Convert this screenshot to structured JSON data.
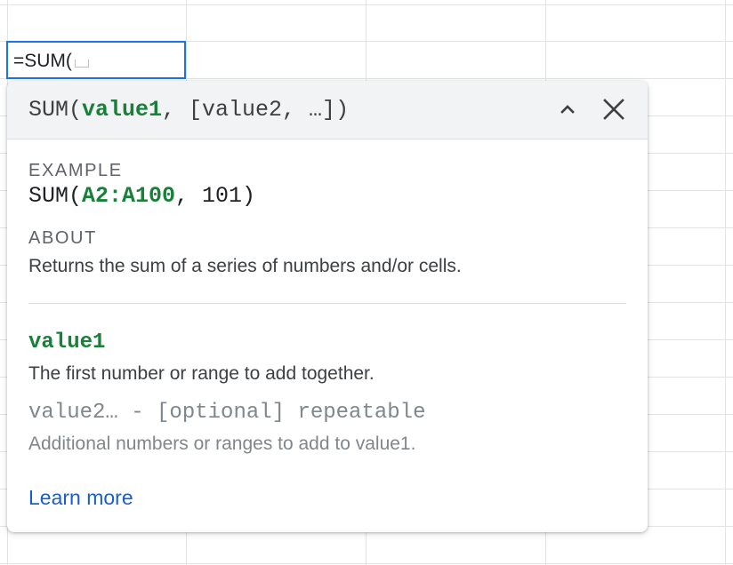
{
  "cell": {
    "formula": "=SUM("
  },
  "popup": {
    "signature": {
      "fn_open": "SUM(",
      "arg1": "value1",
      "rest": ", [value2, …])"
    },
    "example": {
      "label": "EXAMPLE",
      "fn_open": "SUM(",
      "range": "A2:A100",
      "rest": ", 101)"
    },
    "about": {
      "label": "ABOUT",
      "text": "Returns the sum of a series of numbers and/or cells."
    },
    "params": [
      {
        "name": "value1",
        "description": "The first number or range to add together."
      },
      {
        "name": "value2… - [optional] repeatable",
        "description": "Additional numbers or ranges to add to value1."
      }
    ],
    "learn_more": "Learn more"
  },
  "icons": {
    "collapse": "chevron-up-icon",
    "close": "close-icon"
  },
  "colors": {
    "accent_blue": "#1a73e8",
    "param_green": "#188038",
    "link_blue": "#1a5fc9",
    "header_bg": "#f1f3f4"
  }
}
